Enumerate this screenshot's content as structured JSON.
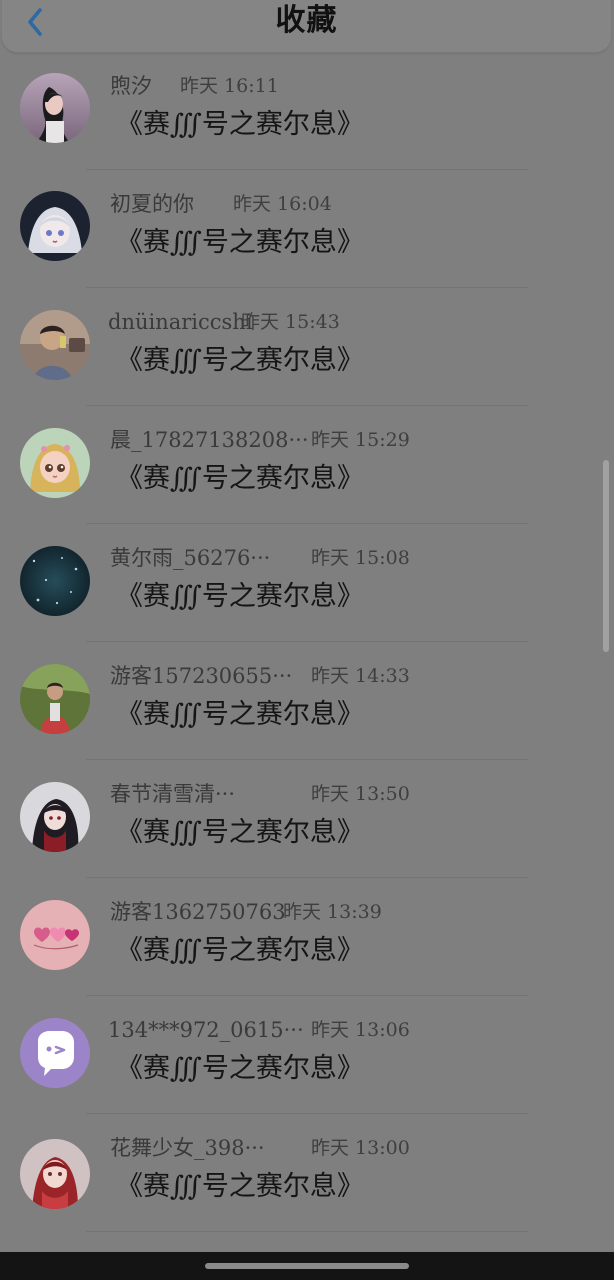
{
  "header": {
    "title": "收藏",
    "back_icon": "chevron-left-icon"
  },
  "colors": {
    "overlay_background": "#7f7f7f",
    "header_background": "#858585",
    "back_icon_color": "#2d69a3",
    "bottom_bar": "#141414"
  },
  "items": [
    {
      "username": "煦汐",
      "timestamp": "昨天 16:11",
      "message": "《赛∭号之赛尔息》",
      "avatar_icon": "girl-avatar-icon"
    },
    {
      "username": "初夏的你",
      "timestamp": "昨天 16:04",
      "message": "《赛∭号之赛尔息》",
      "avatar_icon": "anime-girl-avatar-icon"
    },
    {
      "username": "dnüinariccshi",
      "timestamp": "昨天 15:43",
      "message": "《赛∭号之赛尔息》",
      "avatar_icon": "boy-avatar-icon"
    },
    {
      "username": "晨_17827138208···",
      "timestamp": "昨天 15:29",
      "message": "《赛∭号之赛尔息》",
      "avatar_icon": "cartoon-girl-avatar-icon"
    },
    {
      "username": "黄尔雨_56276···",
      "timestamp": "昨天 15:08",
      "message": "《赛∭号之赛尔息》",
      "avatar_icon": "night-sky-avatar-icon"
    },
    {
      "username": "游客157230655···",
      "timestamp": "昨天 14:33",
      "message": "《赛∭号之赛尔息》",
      "avatar_icon": "outdoor-avatar-icon"
    },
    {
      "username": "春节清雪清···",
      "timestamp": "昨天 13:50",
      "message": "《赛∭号之赛尔息》",
      "avatar_icon": "game-character-avatar-icon"
    },
    {
      "username": "游客1362750763",
      "timestamp": "昨天 13:39",
      "message": "《赛∭号之赛尔息》",
      "avatar_icon": "hearts-avatar-icon"
    },
    {
      "username": "134***972_0615···",
      "timestamp": "昨天 13:06",
      "message": "《赛∭号之赛尔息》",
      "avatar_icon": "chat-bubble-avatar-icon"
    },
    {
      "username": "花舞少女_398···",
      "timestamp": "昨天 13:00",
      "message": "《赛∭号之赛尔息》",
      "avatar_icon": "red-anime-avatar-icon"
    }
  ]
}
